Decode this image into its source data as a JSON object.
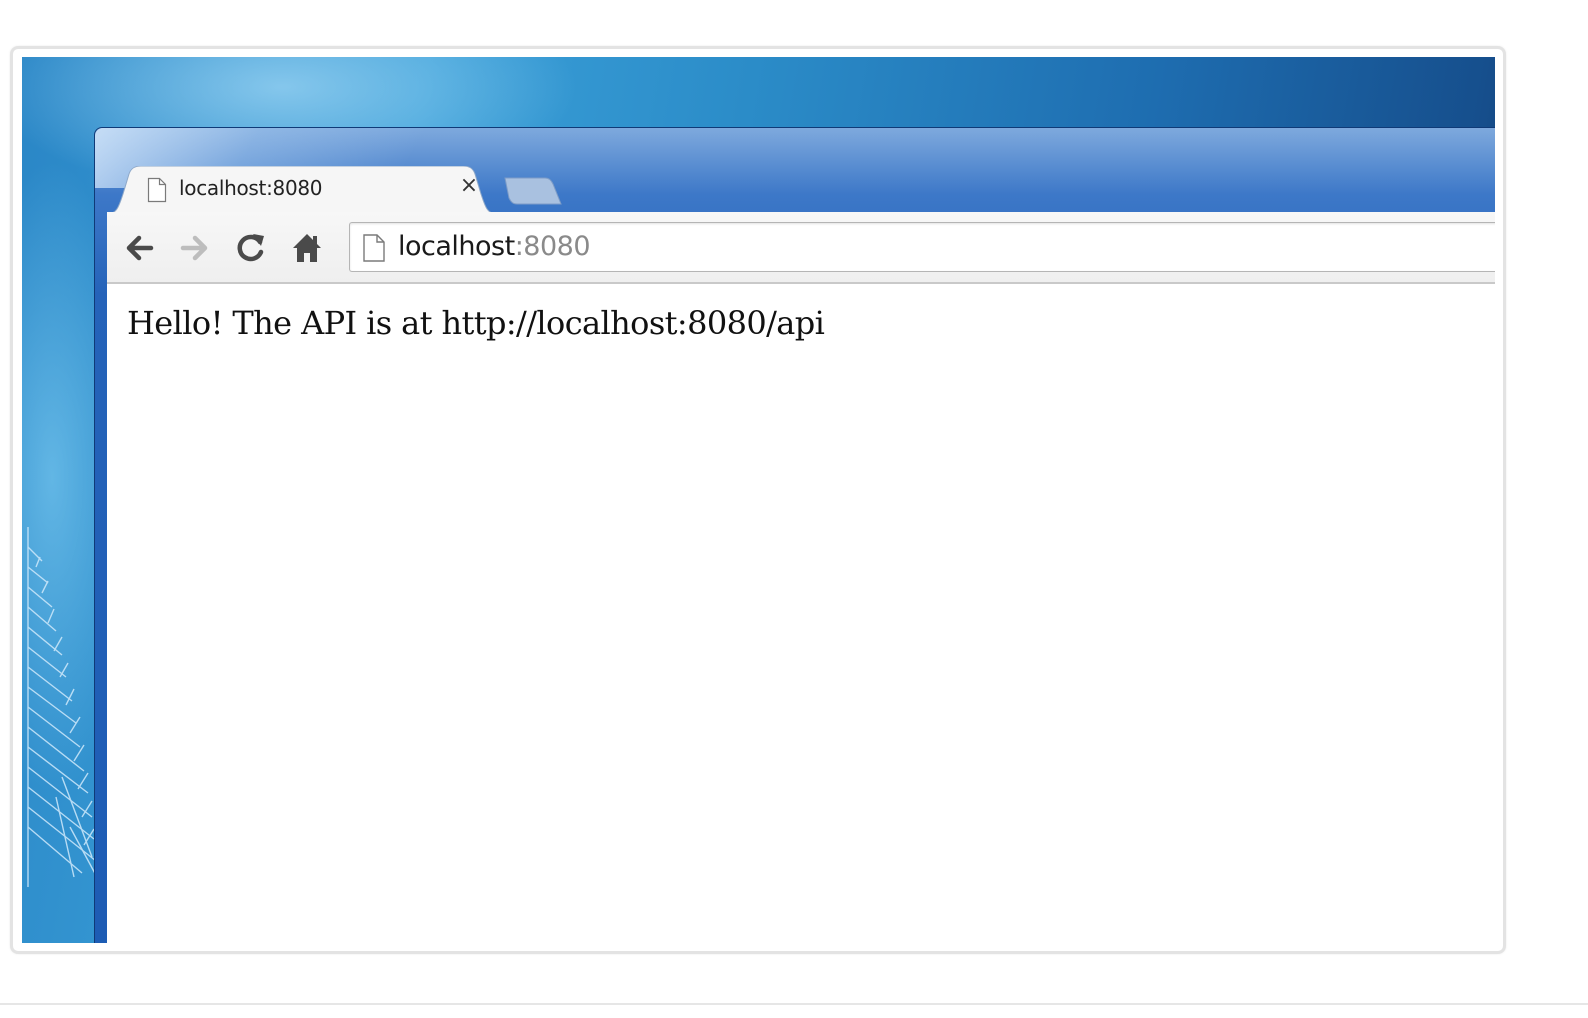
{
  "browser": {
    "tab": {
      "title": "localhost:8080",
      "close_glyph": "×",
      "icon": "page-icon"
    },
    "toolbar": {
      "back_icon": "back-arrow-icon",
      "forward_icon": "forward-arrow-icon",
      "reload_icon": "reload-icon",
      "home_icon": "home-icon"
    },
    "omnibox": {
      "host": "localhost",
      "port": ":8080",
      "icon": "page-icon"
    },
    "page": {
      "body_text": "Hello! The API is at http://localhost:8080/api"
    }
  },
  "colors": {
    "window_frame": "#1d5cb4",
    "toolbar_bg": "#f1f1f1",
    "desktop": "#2b8cc8",
    "port_text": "#8a8a8a"
  }
}
